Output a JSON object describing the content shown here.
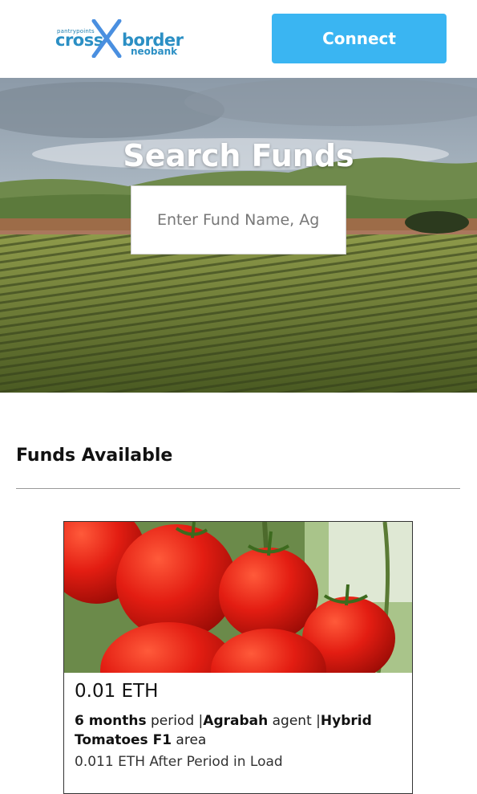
{
  "header": {
    "logo": {
      "small_text": "pantrypoints",
      "word_left": "cross",
      "word_right": "border",
      "word_bottom": "neobank",
      "icon": "cross-x-icon"
    },
    "connect_label": "Connect"
  },
  "hero": {
    "title": "Search Funds",
    "search_placeholder": "Enter Fund Name, Agent, or Area",
    "background": "farm-field-image"
  },
  "funds_section": {
    "title": "Funds Available"
  },
  "fund_card": {
    "image": "tomatoes-image",
    "amount": "0.01 ETH",
    "period_value": "6 months",
    "period_word": " period |",
    "agent_value": "Agrabah",
    "agent_word": " agent |",
    "area_value": "Hybrid Tomatoes F1",
    "area_word": " area",
    "after_period": "0.011 ETH After Period in Load"
  },
  "colors": {
    "accent": "#3ab5f2",
    "logo_blue": "#2b8fc4"
  }
}
